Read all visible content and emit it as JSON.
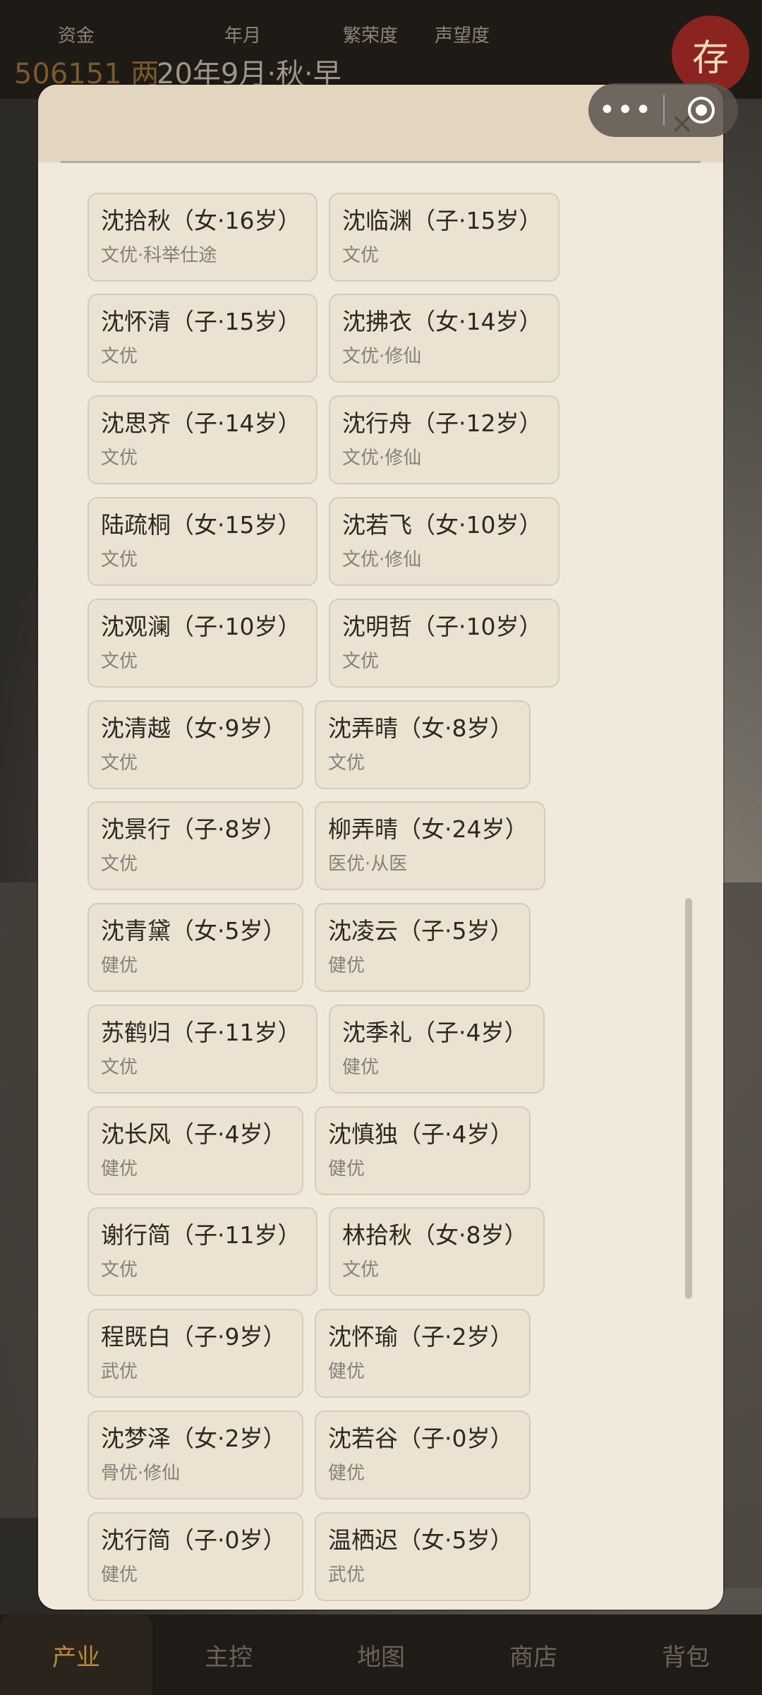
{
  "top_bar": {
    "stats": [
      {
        "label": "资金",
        "value": "506151 两"
      },
      {
        "label": "年月",
        "value": "20年9月·秋·早"
      },
      {
        "label": "繁荣度",
        "value": ""
      },
      {
        "label": "声望度",
        "value": ""
      }
    ],
    "save_label": "存"
  },
  "capsule": {
    "more_icon": "more-dots-icon",
    "close_icon": "target-circle-icon"
  },
  "modal": {
    "close_glyph": "×"
  },
  "cards": [
    [
      {
        "title": "沈拾秋（女·16岁）",
        "sub": "文优·科举仕途"
      },
      {
        "title": "沈临渊（子·15岁）",
        "sub": "文优"
      }
    ],
    [
      {
        "title": "沈怀清（子·15岁）",
        "sub": "文优"
      },
      {
        "title": "沈拂衣（女·14岁）",
        "sub": "文优·修仙"
      }
    ],
    [
      {
        "title": "沈思齐（子·14岁）",
        "sub": "文优"
      },
      {
        "title": "沈行舟（子·12岁）",
        "sub": "文优·修仙"
      }
    ],
    [
      {
        "title": "陆疏桐（女·15岁）",
        "sub": "文优"
      },
      {
        "title": "沈若飞（女·10岁）",
        "sub": "文优·修仙"
      }
    ],
    [
      {
        "title": "沈观澜（子·10岁）",
        "sub": "文优"
      },
      {
        "title": "沈明哲（子·10岁）",
        "sub": "文优"
      }
    ],
    [
      {
        "title": "沈清越（女·9岁）",
        "sub": "文优"
      },
      {
        "title": "沈弄晴（女·8岁）",
        "sub": "文优"
      }
    ],
    [
      {
        "title": "沈景行（子·8岁）",
        "sub": "文优"
      },
      {
        "title": "柳弄晴（女·24岁）",
        "sub": "医优·从医"
      }
    ],
    [
      {
        "title": "沈青黛（女·5岁）",
        "sub": "健优"
      },
      {
        "title": "沈凌云（子·5岁）",
        "sub": "健优"
      }
    ],
    [
      {
        "title": "苏鹤归（子·11岁）",
        "sub": "文优"
      },
      {
        "title": "沈季礼（子·4岁）",
        "sub": "健优"
      }
    ],
    [
      {
        "title": "沈长风（子·4岁）",
        "sub": "健优"
      },
      {
        "title": "沈慎独（子·4岁）",
        "sub": "健优"
      }
    ],
    [
      {
        "title": "谢行简（子·11岁）",
        "sub": "文优"
      },
      {
        "title": "林拾秋（女·8岁）",
        "sub": "文优"
      }
    ],
    [
      {
        "title": "程既白（子·9岁）",
        "sub": "武优"
      },
      {
        "title": "沈怀瑜（子·2岁）",
        "sub": "健优"
      }
    ],
    [
      {
        "title": "沈梦泽（女·2岁）",
        "sub": "骨优·修仙"
      },
      {
        "title": "沈若谷（子·0岁）",
        "sub": "健优"
      }
    ],
    [
      {
        "title": "沈行简（子·0岁）",
        "sub": "健优"
      },
      {
        "title": "温栖迟（女·5岁）",
        "sub": "武优"
      }
    ]
  ],
  "bottom_nav": {
    "tabs": [
      "产业",
      "主控",
      "地图",
      "商店",
      "背包"
    ],
    "active": "产业"
  }
}
